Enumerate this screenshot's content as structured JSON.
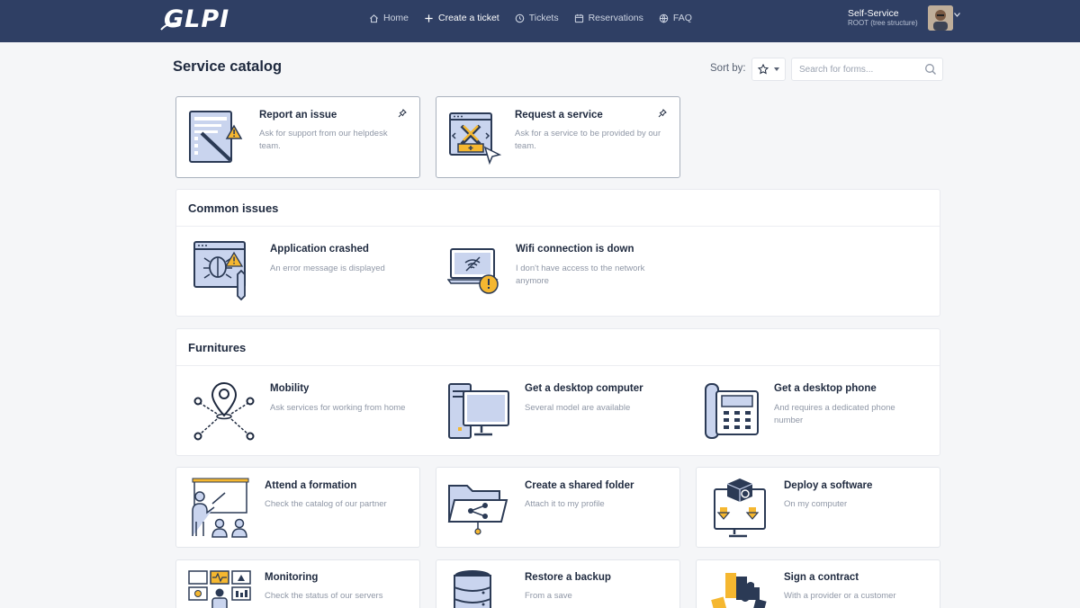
{
  "nav": {
    "logo": "GLPI",
    "items": [
      {
        "label": "Home",
        "icon": "home-icon"
      },
      {
        "label": "Create a ticket",
        "icon": "plus-icon"
      },
      {
        "label": "Tickets",
        "icon": "clock-icon"
      },
      {
        "label": "Reservations",
        "icon": "calendar-icon"
      },
      {
        "label": "FAQ",
        "icon": "globe-icon"
      }
    ],
    "user_name": "Self-Service",
    "user_entity": "ROOT (tree structure)"
  },
  "page": {
    "title": "Service catalog",
    "sort_label": "Sort by:",
    "search_placeholder": "Search for forms..."
  },
  "pinned": [
    {
      "title": "Report an issue",
      "desc": "Ask for support from our helpdesk team."
    },
    {
      "title": "Request a service",
      "desc": "Ask for a service to be provided by our team."
    }
  ],
  "common_issues": {
    "title": "Common issues",
    "items": [
      {
        "title": "Application crashed",
        "desc": "An error message is displayed"
      },
      {
        "title": "Wifi connection is down",
        "desc": "I don't have access to the network anymore"
      }
    ]
  },
  "furnitures": {
    "title": "Furnitures",
    "items": [
      {
        "title": "Mobility",
        "desc": "Ask services for working from home"
      },
      {
        "title": "Get a desktop computer",
        "desc": "Several model are available"
      },
      {
        "title": "Get a desktop phone",
        "desc": "And requires a dedicated phone number"
      }
    ]
  },
  "forms": [
    {
      "title": "Attend a formation",
      "desc": "Check the catalog of our partner"
    },
    {
      "title": "Create a shared folder",
      "desc": "Attach it to my profile"
    },
    {
      "title": "Deploy a software",
      "desc": "On my computer"
    },
    {
      "title": "Monitoring",
      "desc": "Check the status of our servers"
    },
    {
      "title": "Restore a backup",
      "desc": "From a save"
    },
    {
      "title": "Sign a contract",
      "desc": "With a provider or a customer"
    }
  ],
  "colors": {
    "navbar": "#2f3f64",
    "accent": "#f5b730",
    "illustration_blue": "#c9d4ee",
    "illustration_dark": "#2b3a55"
  }
}
